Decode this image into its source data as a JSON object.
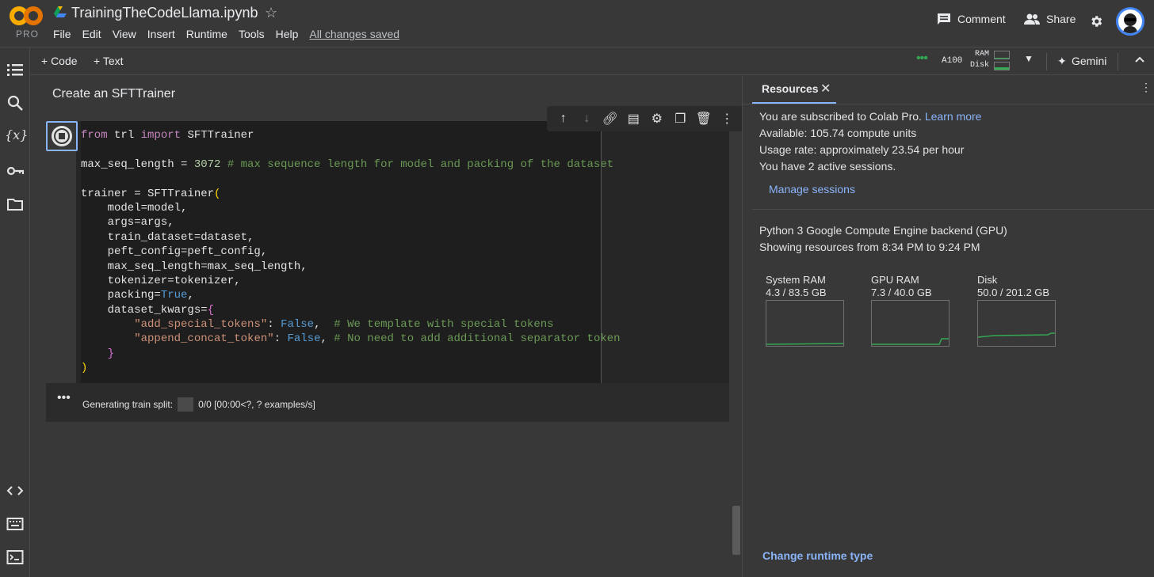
{
  "app": {
    "logo_badge": "PRO",
    "notebook_title": "TrainingTheCodeLlama.ipynb"
  },
  "menu": {
    "items": [
      "File",
      "Edit",
      "View",
      "Insert",
      "Runtime",
      "Tools",
      "Help"
    ],
    "saved": "All changes saved"
  },
  "header_right": {
    "comment": "Comment",
    "share": "Share"
  },
  "toolbar": {
    "add_code": "+ Code",
    "add_text": "+ Text",
    "gpu": "A100",
    "ram": "RAM",
    "disk": "Disk",
    "gemini": "Gemini"
  },
  "section": {
    "heading": "Create an SFTTrainer"
  },
  "code_lines": [
    "from trl import SFTTrainer",
    "",
    "max_seq_length = 3072 # max sequence length for model and packing of the dataset",
    "",
    "trainer = SFTTrainer(",
    "    model=model,",
    "    args=args,",
    "    train_dataset=dataset,",
    "    peft_config=peft_config,",
    "    max_seq_length=max_seq_length,",
    "    tokenizer=tokenizer,",
    "    packing=True,",
    "    dataset_kwargs={",
    "        \"add_special_tokens\": False,  # We template with special tokens",
    "        \"append_concat_token\": False, # No need to add additional separator token",
    "    }",
    ")"
  ],
  "output": {
    "label": "Generating train split:",
    "progress": "0/0 [00:00<?, ? examples/s]"
  },
  "resources": {
    "tab": "Resources",
    "subscribed": "You are subscribed to Colab Pro.",
    "learn_more": "Learn more",
    "available": "Available: 105.74 compute units",
    "usage": "Usage rate: approximately 23.54 per hour",
    "sessions": "You have 2 active sessions.",
    "manage": "Manage sessions",
    "backend": "Python 3 Google Compute Engine backend (GPU)",
    "showing": "Showing resources from 8:34 PM to 9:24 PM",
    "graphs": [
      {
        "name": "System RAM",
        "value": "4.3 / 83.5 GB"
      },
      {
        "name": "GPU RAM",
        "value": "7.3 / 40.0 GB"
      },
      {
        "name": "Disk",
        "value": "50.0 / 201.2 GB"
      }
    ],
    "change_runtime": "Change runtime type"
  },
  "colors": {
    "accent": "#8ab4f8",
    "graph_line": "#34a853",
    "logo_orange": "#f9ab00"
  }
}
